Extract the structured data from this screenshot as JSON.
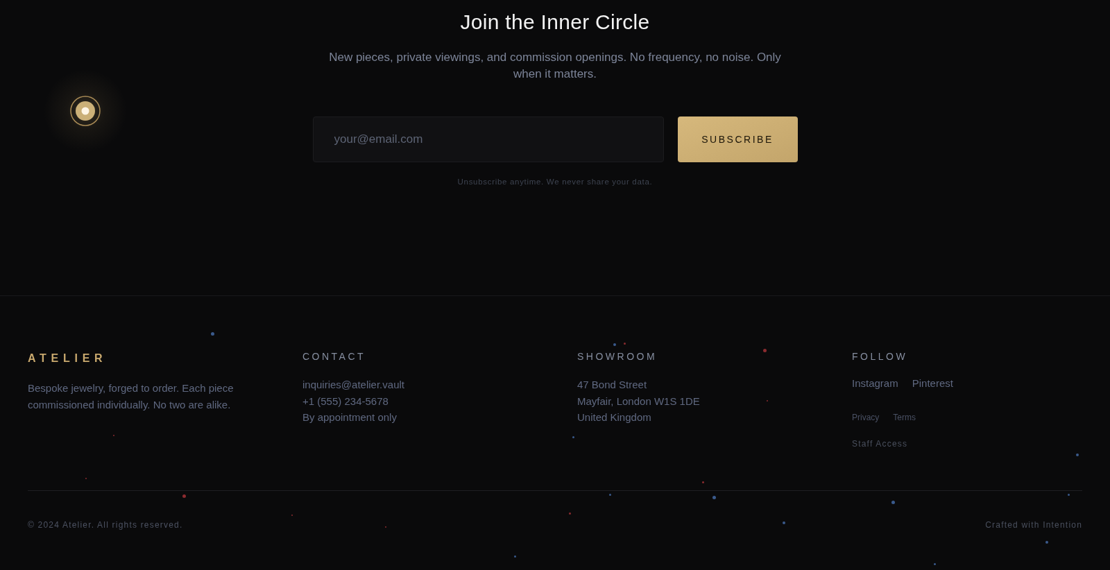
{
  "newsletter": {
    "title": "Join the Inner Circle",
    "subtitle": "New pieces, private viewings, and commission openings. No frequency, no noise. Only when it matters.",
    "email_field": {
      "placeholder": "your@email.com"
    },
    "subscribe_button": "SUBSCRIBE",
    "note": "Unsubscribe anytime. We never share your data."
  },
  "footer": {
    "brand": {
      "name": "ATELIER",
      "description": "Bespoke jewelry, forged to order. Each piece commissioned individually. No two are alike."
    },
    "columns": [
      {
        "heading": "CONTACT",
        "lines": [
          "inquiries@atelier.vault",
          "+1 (555) 234-5678",
          "By appointment only"
        ]
      },
      {
        "heading": "SHOWROOM",
        "lines": [
          "47 Bond Street",
          "Mayfair, London W1S 1DE",
          "United Kingdom"
        ]
      }
    ],
    "follow": {
      "heading": "FOLLOW",
      "social_links": [
        "Instagram",
        "Pinterest"
      ],
      "legal_links": [
        "Privacy",
        "Terms"
      ],
      "staff_link": "Staff Access"
    },
    "copyright": "© 2024 Atelier. All rights reserved.",
    "tagline": "Crafted with Intention"
  }
}
